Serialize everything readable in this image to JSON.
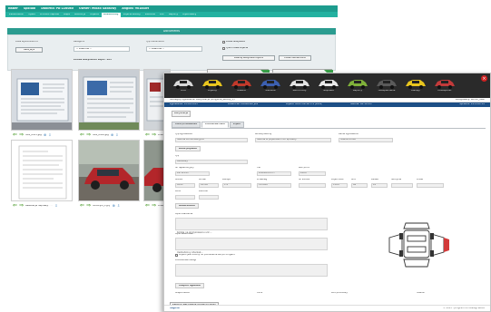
{
  "back_window": {
    "topbar": [
      "Naber",
      "Spoluol",
      "Dobirna: PA-228080",
      "Owner: Mikail Sadavuy",
      "Anglos: 9018409"
    ],
    "tabs": [
      "Zadarnienie",
      "Pojazd",
      "Protokol napraw",
      "Mapa",
      "Kosztorys",
      "Zdjecie",
      "Dokumenty",
      "Zdjecia szkody",
      "Zlecenia",
      "Doc",
      "Raporty",
      "Wykonawcy"
    ],
    "active_tab": 6,
    "band_title": "Documents",
    "filter": {
      "date_label": "Data wykonania od",
      "date_button": "Data_wyk",
      "category_label": "Kategoria",
      "category_value": "-- Dowolne --",
      "type_label": "Typ dokumentu",
      "type_value": "-- Dowolne --",
      "count_label": "Liczba wszystkich zdjec: 105",
      "check_1": "Pokaz wszystkie",
      "check_2": "Tylko nowe zdjecia",
      "button_1": "Zaladuj wszystkie zdjecia",
      "button_2": "Pokaz zaznaczone"
    },
    "photos": [
      {
        "caption": "IMG_0455.jpg"
      },
      {
        "caption": "IMG_0456.jpg"
      },
      {
        "caption": "Prze"
      },
      {
        "caption": "Realizacja naprawy****"
      },
      {
        "caption": "Motocykl_1.jpg"
      },
      {
        "caption": "Przegl..."
      }
    ]
  },
  "front_window": {
    "close_icon": "close-icon",
    "cars": [
      {
        "label": "Brat"
      },
      {
        "label": "Pojazdy"
      },
      {
        "label": "Wlasne"
      },
      {
        "label": "Zlecenia"
      },
      {
        "label": "Samochody"
      },
      {
        "label": "Naprawa"
      },
      {
        "label": "Raporty"
      },
      {
        "label": "Ubezpieczenia"
      },
      {
        "label": "Zakupy"
      },
      {
        "label": "Dostepnosc"
      }
    ],
    "info_line": "Szczegoly zgloszenia: Weryfikacja (Przyjecie_szkody_1)",
    "info_right": "Zalogowany: admin_user",
    "date_bar": [
      "Zgloszenie: 12-02-2015",
      "Wlasciciel: KOWALSKI JAN",
      "Pojazd: OPEL ASTRA 1.4 (2009)",
      "Szkoda: KR 12345"
    ],
    "date_right": "Sprawdz: 2015-02-12",
    "top_button": "Weryfikacja",
    "tabs": [
      "Dane podstawowe",
      "Dodatkowe dane",
      "Pojazd"
    ],
    "form": {
      "l1": "Typ zgloszenia",
      "v1": "Szkoda komunikacyjna",
      "l2": "Rodzaj szkody",
      "v2": "Szkoda w pojezdzie z OC sprawcy",
      "l3": "Kanal zgloszenia",
      "v3": "Telefonicznie",
      "section_1": "Dane pojazdu",
      "l4": "Typ",
      "v4": "Osobowy",
      "l5": "Nr rejestracyjny",
      "v5": "KR 12345",
      "l6": "VIN",
      "v6": "W0L0AHL35...",
      "l7": "Rok prod.",
      "v7": "2009",
      "l8": "Marka",
      "v8": "OPEL",
      "l9": "Model",
      "v9": "ASTRA",
      "l10": "Wersja",
      "v10": "1.4",
      "l11": "Przebieg",
      "v11": "125000",
      "l12": "Nr silnika",
      "v12": "",
      "l13": "Kolor",
      "v13": "",
      "l14": "Wartosc",
      "v14": "",
      "l15": "Pojemnosc",
      "v15": "1364",
      "l16": "Moc",
      "v16": "66",
      "l17": "Paliwo",
      "v17": "PB",
      "l18": "Skrzynia",
      "v18": "",
      "l19": "Drzwi",
      "v19": "",
      "section_2": "Okolicznosci",
      "l20": "Opis zdarzenia",
      "v20": "Kolizja na skrzyzowaniu ulic...",
      "l21": "Opis uszkodzen",
      "v21": "Uszkodzony zderzak...",
      "check_label": "Pojazd jest zdolny do poruszania sie po drogach",
      "l22": "Dodatkowe uwagi",
      "section_3": "Miejsce ogledzin",
      "l23": "Miejscowosc",
      "l24": "Ulica",
      "l25": "Kod pocztowy",
      "l26": "Telefon"
    },
    "footer_button": "Zakoncz weryfikacje (Dodaj do Akta)",
    "footer_brand": "Sagitta",
    "footer_right": "© 2015 - program do obslugi szkod"
  }
}
